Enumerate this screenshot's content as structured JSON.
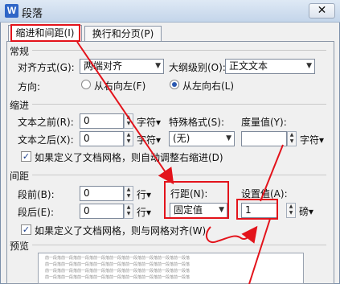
{
  "window": {
    "title": "段落",
    "close_glyph": "✕",
    "app_icon_letter": "W"
  },
  "tabs": [
    {
      "label": "缩进和间距(I)",
      "active": true
    },
    {
      "label": "换行和分页(P)",
      "active": false
    }
  ],
  "general": {
    "section": "常规",
    "alignment_label": "对齐方式(G):",
    "alignment_value": "两端对齐",
    "outline_label": "大纲级别(O):",
    "outline_value": "正文文本",
    "direction_label": "方向:",
    "rtl_label": "从右向左(F)",
    "ltr_label": "从左向右(L)",
    "direction_selected": "ltr"
  },
  "indent": {
    "section": "缩进",
    "before_label": "文本之前(R):",
    "before_value": "0",
    "before_unit": "字符▾",
    "after_label": "文本之后(X):",
    "after_value": "0",
    "after_unit": "字符▾",
    "special_label": "特殊格式(S):",
    "special_value": "(无)",
    "measure_label": "度量值(Y):",
    "measure_value": "",
    "measure_unit": "字符▾",
    "auto_adjust_label": "如果定义了文档网格，则自动调整右缩进(D)",
    "auto_adjust_checked": true
  },
  "spacing": {
    "section": "间距",
    "before_label": "段前(B):",
    "before_value": "0",
    "before_unit": "行▾",
    "after_label": "段后(E):",
    "after_value": "0",
    "after_unit": "行▾",
    "line_spacing_label": "行距(N):",
    "line_spacing_value": "固定值",
    "set_value_label": "设置值(A):",
    "set_value_value": "1",
    "set_value_unit": "磅▾",
    "snap_grid_label": "如果定义了文档网格，则与网格对齐(W)",
    "snap_grid_checked": true
  },
  "preview": {
    "section": "预览",
    "sample_text": "前一段落前一段落前一段落前一段落前一段落前一段落前一段落前一段落前一段落"
  },
  "colors": {
    "annotation_red": "#e3131b"
  }
}
